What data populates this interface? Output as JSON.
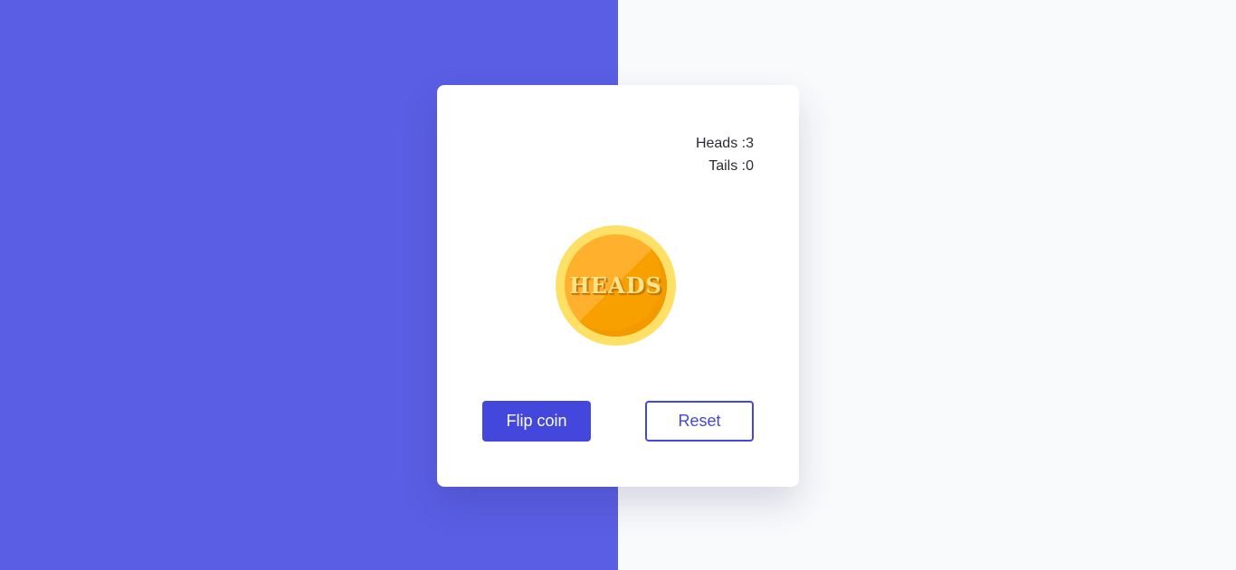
{
  "colors": {
    "left_background": "#5a5ee4",
    "right_background": "#f9fafc",
    "accent": "#4447dc",
    "coin_rim": "#ffe066",
    "coin_face": "#ffb12e"
  },
  "stats": {
    "heads_label": "Heads :3",
    "tails_label": "Tails :0"
  },
  "coin": {
    "face_text": "HEADS",
    "icon": "coin-icon"
  },
  "buttons": {
    "flip_label": "Flip coin",
    "reset_label": "Reset"
  }
}
